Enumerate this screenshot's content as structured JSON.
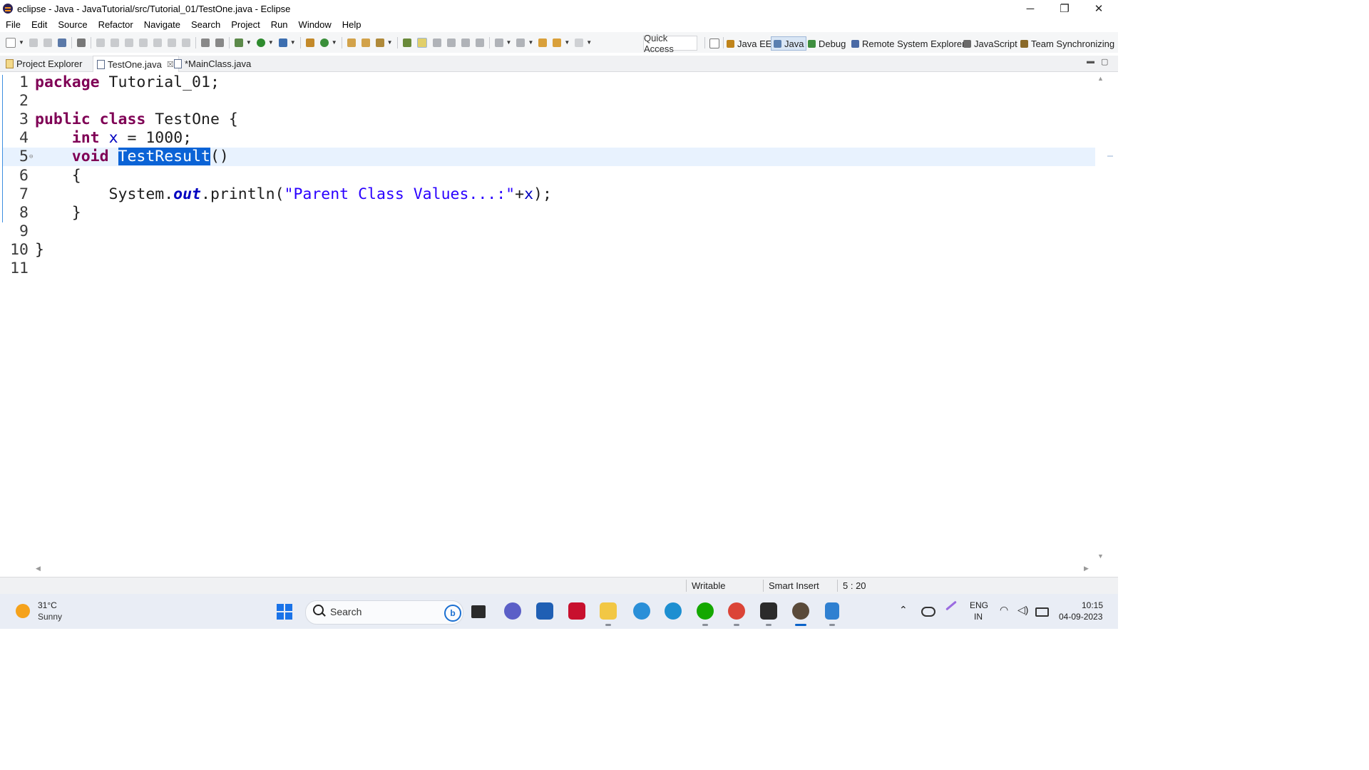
{
  "window": {
    "title": "eclipse - Java - JavaTutorial/src/Tutorial_01/TestOne.java - Eclipse",
    "minimize": "─",
    "maximize": "❐",
    "close": "✕"
  },
  "menu": [
    "File",
    "Edit",
    "Source",
    "Refactor",
    "Navigate",
    "Search",
    "Project",
    "Run",
    "Window",
    "Help"
  ],
  "toolbar": {
    "quick_access": "Quick Access",
    "perspectives": [
      {
        "label": "Java EE",
        "color": "#c0841a",
        "active": false
      },
      {
        "label": "Java",
        "color": "#5a7fb0",
        "active": true
      },
      {
        "label": "Debug",
        "color": "#3f8f3f",
        "active": false
      },
      {
        "label": "Remote System Explorer",
        "color": "#4a6aa5",
        "active": false
      },
      {
        "label": "JavaScript",
        "color": "#6a6a6a",
        "active": false
      },
      {
        "label": "Team Synchronizing",
        "color": "#8a6a2a",
        "active": false
      }
    ]
  },
  "tabs": [
    {
      "label": "Project Explorer",
      "icon": "folder-icon",
      "active": false,
      "close": ""
    },
    {
      "label": "TestOne.java",
      "icon": "java-file-icon",
      "active": true,
      "close": "☒"
    },
    {
      "label": "*MainClass.java",
      "icon": "java-file-icon",
      "active": false,
      "close": ""
    }
  ],
  "editor": {
    "current_line": 5,
    "lines": [
      {
        "n": "1",
        "code": "package Tutorial_01;"
      },
      {
        "n": "2",
        "code": ""
      },
      {
        "n": "3",
        "code": "public class TestOne {"
      },
      {
        "n": "4",
        "code": "    int x = 1000;"
      },
      {
        "n": "5",
        "code": "    void TestResult()"
      },
      {
        "n": "6",
        "code": "    {"
      },
      {
        "n": "7",
        "code": "        System.out.println(\"Parent Class Values...:\"+x);"
      },
      {
        "n": "8",
        "code": "    }"
      },
      {
        "n": "9",
        "code": ""
      },
      {
        "n": "10",
        "code": "}"
      },
      {
        "n": "11",
        "code": ""
      }
    ],
    "selected_text": "TestResult"
  },
  "status": {
    "writable": "Writable",
    "insert_mode": "Smart Insert",
    "position": "5 : 20"
  },
  "taskbar": {
    "weather_temp": "31°C",
    "weather_cond": "Sunny",
    "search_label": "Search",
    "bing_label": "b",
    "lang": "ENG",
    "region": "IN",
    "time": "10:15",
    "date": "04-09-2023"
  },
  "colors": {
    "keyword": "#7f0055",
    "field": "#0000c0",
    "string": "#2a00ff",
    "selection": "#0b63d6",
    "current_line": "#e8f2fe"
  }
}
